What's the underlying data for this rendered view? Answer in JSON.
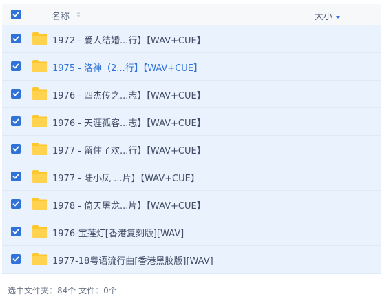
{
  "colors": {
    "accent": "#2f72d8",
    "row_selected_bg": "#eaf2fd",
    "folder": "#ffcb3d"
  },
  "header": {
    "select_all_checked": true,
    "name_label": "名称",
    "size_label": "大小"
  },
  "files": [
    {
      "name": "1972 - 爱人结婚...行】【WAV+CUE】",
      "checked": true,
      "icon": "folder-icon"
    },
    {
      "name": "1975 - 洛神（2...行】【WAV+CUE】",
      "checked": true,
      "icon": "folder-icon",
      "hover": true
    },
    {
      "name": "1976 - 四杰传之...志】【WAV+CUE】",
      "checked": true,
      "icon": "folder-icon"
    },
    {
      "name": "1976 - 天涯孤客...志】【WAV+CUE】",
      "checked": true,
      "icon": "folder-icon"
    },
    {
      "name": "1977 - 留住了欢...行】【WAV+CUE】",
      "checked": true,
      "icon": "folder-icon"
    },
    {
      "name": "1977 - 陆小凤 ...片】【WAV+CUE】",
      "checked": true,
      "icon": "folder-icon"
    },
    {
      "name": "1978 - 倚天屠龙...片】【WAV+CUE】",
      "checked": true,
      "icon": "folder-icon"
    },
    {
      "name": "1976-宝莲灯[香港复刻版][WAV]",
      "checked": true,
      "icon": "folder-icon"
    },
    {
      "name": "1977-18粤语流行曲[香港黑胶版][WAV]",
      "checked": true,
      "icon": "folder-icon"
    }
  ],
  "status": {
    "text": "选中文件夹：84个 文件：0个"
  }
}
